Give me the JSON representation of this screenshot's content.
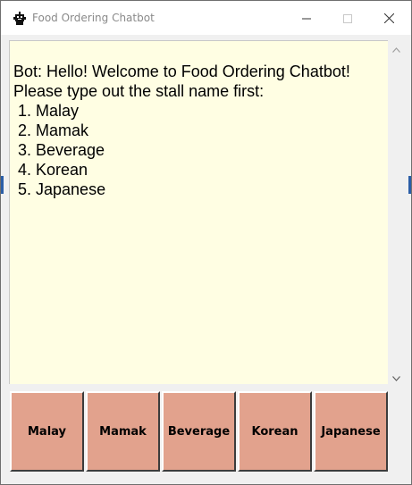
{
  "window": {
    "title": "Food Ordering Chatbot",
    "icon": "robot-icon",
    "controls": {
      "minimize_icon": "minimize-icon",
      "maximize_icon": "maximize-icon",
      "close_icon": "close-icon"
    }
  },
  "chat": {
    "background_color": "#fffee3",
    "text": "Bot: Hello! Welcome to Food Ordering Chatbot!\nPlease type out the stall name first:\n 1. Malay\n 2. Mamak\n 3. Beverage\n 4. Korean\n 5. Japanese"
  },
  "buttons": {
    "color": "#e2a28d",
    "labels": [
      "Malay",
      "Mamak",
      "Beverage",
      "Korean",
      "Japanese"
    ]
  }
}
